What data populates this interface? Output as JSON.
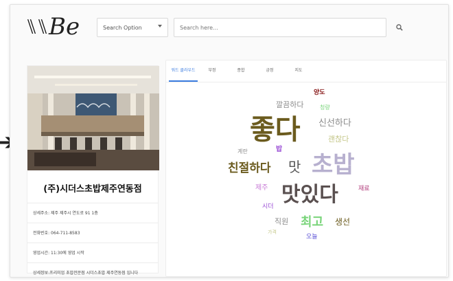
{
  "header": {
    "logo_text": "Be",
    "search_option_label": "Search Option",
    "search_placeholder": "Search here..."
  },
  "store": {
    "name": "(주)시더스초밥제주연동점",
    "address": "상세주소: 제주 제주시 연도로 91 1층",
    "phone": "전화번호: 064-711-8583",
    "hours": "영업시간: 11:30에 영업 시작",
    "description": "상세정보:프리미엄 초밥전문점 시더스초밥 제주연동점 입니다"
  },
  "tabs": [
    {
      "label": "워드 클라우드",
      "active": true
    },
    {
      "label": "부정",
      "active": false
    },
    {
      "label": "종합",
      "active": false
    },
    {
      "label": "긍정",
      "active": false
    },
    {
      "label": "지도",
      "active": false
    }
  ],
  "word_cloud": [
    {
      "text": "양도",
      "color": "#8b1e1e"
    },
    {
      "text": "깔끔하다",
      "color": "#8c8c8c"
    },
    {
      "text": "청량",
      "color": "#79d47a"
    },
    {
      "text": "좋다",
      "color": "#6b5b1e"
    },
    {
      "text": "신선하다",
      "color": "#8c8c8c"
    },
    {
      "text": "괜찮다",
      "color": "#c5c78a"
    },
    {
      "text": "계란",
      "color": "#8c8c8c"
    },
    {
      "text": "밥",
      "color": "#9b4fd6"
    },
    {
      "text": "친절하다",
      "color": "#6b5b1e"
    },
    {
      "text": "맛",
      "color": "#555555"
    },
    {
      "text": "초밥",
      "color": "#b7b0cf"
    },
    {
      "text": "제주",
      "color": "#c77ad6"
    },
    {
      "text": "맛있다",
      "color": "#5a5050"
    },
    {
      "text": "재료",
      "color": "#b03a7a"
    },
    {
      "text": "시더",
      "color": "#9b4fd6"
    },
    {
      "text": "직원",
      "color": "#8c8c8c"
    },
    {
      "text": "최고",
      "color": "#79d47a"
    },
    {
      "text": "생선",
      "color": "#6b5b1e"
    },
    {
      "text": "가격",
      "color": "#c5c78a"
    },
    {
      "text": "오늘",
      "color": "#5a4fd6"
    }
  ]
}
